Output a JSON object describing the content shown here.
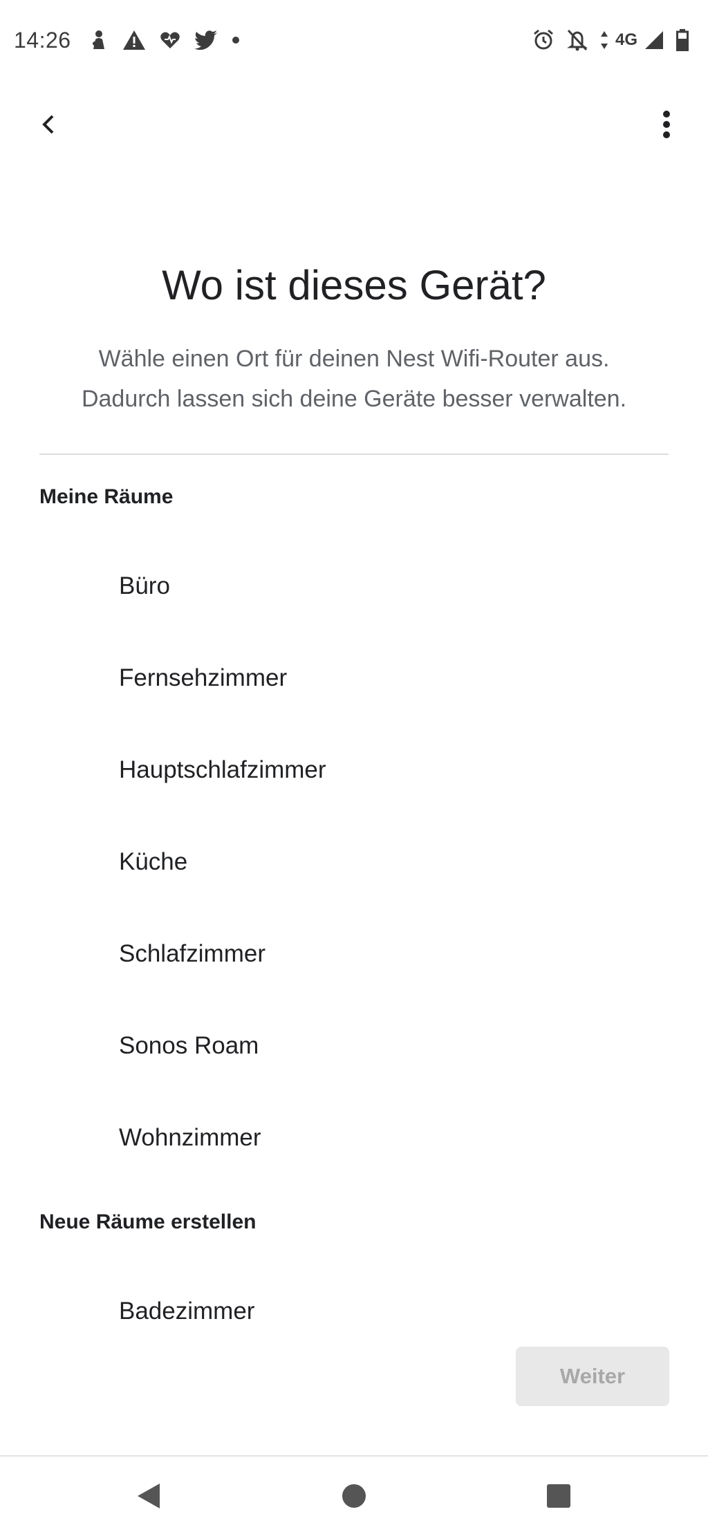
{
  "status_bar": {
    "time": "14:26",
    "network": "4G",
    "left_icons": [
      "person-icon",
      "warning-icon",
      "heart-icon",
      "twitter-icon",
      "dot-icon"
    ],
    "right_icons": [
      "alarm-icon",
      "notifications-off-icon",
      "data-arrows-icon",
      "signal-icon",
      "battery-icon"
    ]
  },
  "header": {
    "title": "Wo ist dieses Gerät?",
    "subtitle_line1": "Wähle einen Ort für deinen Nest Wifi-Router aus.",
    "subtitle_line2": "Dadurch lassen sich deine Geräte besser verwalten."
  },
  "my_rooms": {
    "label": "Meine Räume",
    "items": [
      "Büro",
      "Fernsehzimmer",
      "Hauptschlafzimmer",
      "Küche",
      "Schlafzimmer",
      "Sonos Roam",
      "Wohnzimmer"
    ]
  },
  "new_rooms": {
    "label": "Neue Räume erstellen",
    "items": [
      "Badezimmer"
    ]
  },
  "actions": {
    "next_label": "Weiter"
  },
  "colors": {
    "text_primary": "#202124",
    "text_secondary": "#5f6368",
    "divider": "#dadce0",
    "disabled_button_bg": "#e8e8e8",
    "disabled_button_text": "#a8a8a8"
  }
}
